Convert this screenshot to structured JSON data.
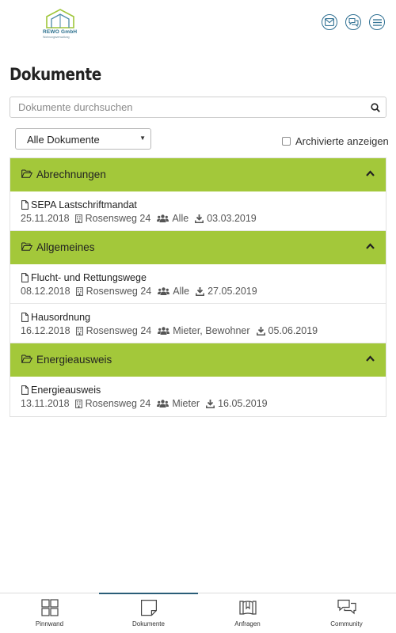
{
  "header": {
    "logo_name": "REWO GmbH",
    "logo_sub": "Wohnungsverwaltung",
    "icons": [
      "mail-icon",
      "chat-icon",
      "menu-icon"
    ]
  },
  "page": {
    "title": "Dokumente"
  },
  "search": {
    "placeholder": "Dokumente durchsuchen",
    "value": ""
  },
  "filter": {
    "selected": "Alle Dokumente",
    "archive_label": "Archivierte anzeigen",
    "archive_checked": false
  },
  "groups": [
    {
      "title": "Abrechnungen",
      "items": [
        {
          "name": "SEPA Lastschriftmandat",
          "date": "25.11.2018",
          "building": "Rosensweg 24",
          "audience": "Alle",
          "download_date": "03.03.2019"
        }
      ]
    },
    {
      "title": "Allgemeines",
      "items": [
        {
          "name": "Flucht- und Rettungswege",
          "date": "08.12.2018",
          "building": "Rosensweg 24",
          "audience": "Alle",
          "download_date": "27.05.2019"
        },
        {
          "name": "Hausordnung",
          "date": "16.12.2018",
          "building": "Rosensweg 24",
          "audience": "Mieter, Bewohner",
          "download_date": "05.06.2019"
        }
      ]
    },
    {
      "title": "Energieausweis",
      "items": [
        {
          "name": "Energieausweis",
          "date": "13.11.2018",
          "building": "Rosensweg 24",
          "audience": "Mieter",
          "download_date": "16.05.2019"
        }
      ]
    }
  ],
  "nav": {
    "items": [
      {
        "label": "Pinnwand",
        "icon": "grid-icon",
        "active": false
      },
      {
        "label": "Dokumente",
        "icon": "document-icon",
        "active": true
      },
      {
        "label": "Anfragen",
        "icon": "book-icon",
        "active": false
      },
      {
        "label": "Community",
        "icon": "chat-bubbles-icon",
        "active": false
      }
    ]
  },
  "colors": {
    "accent_green": "#a3c83a",
    "brand_blue": "#2e6f92",
    "active_nav": "#2a5d78"
  }
}
